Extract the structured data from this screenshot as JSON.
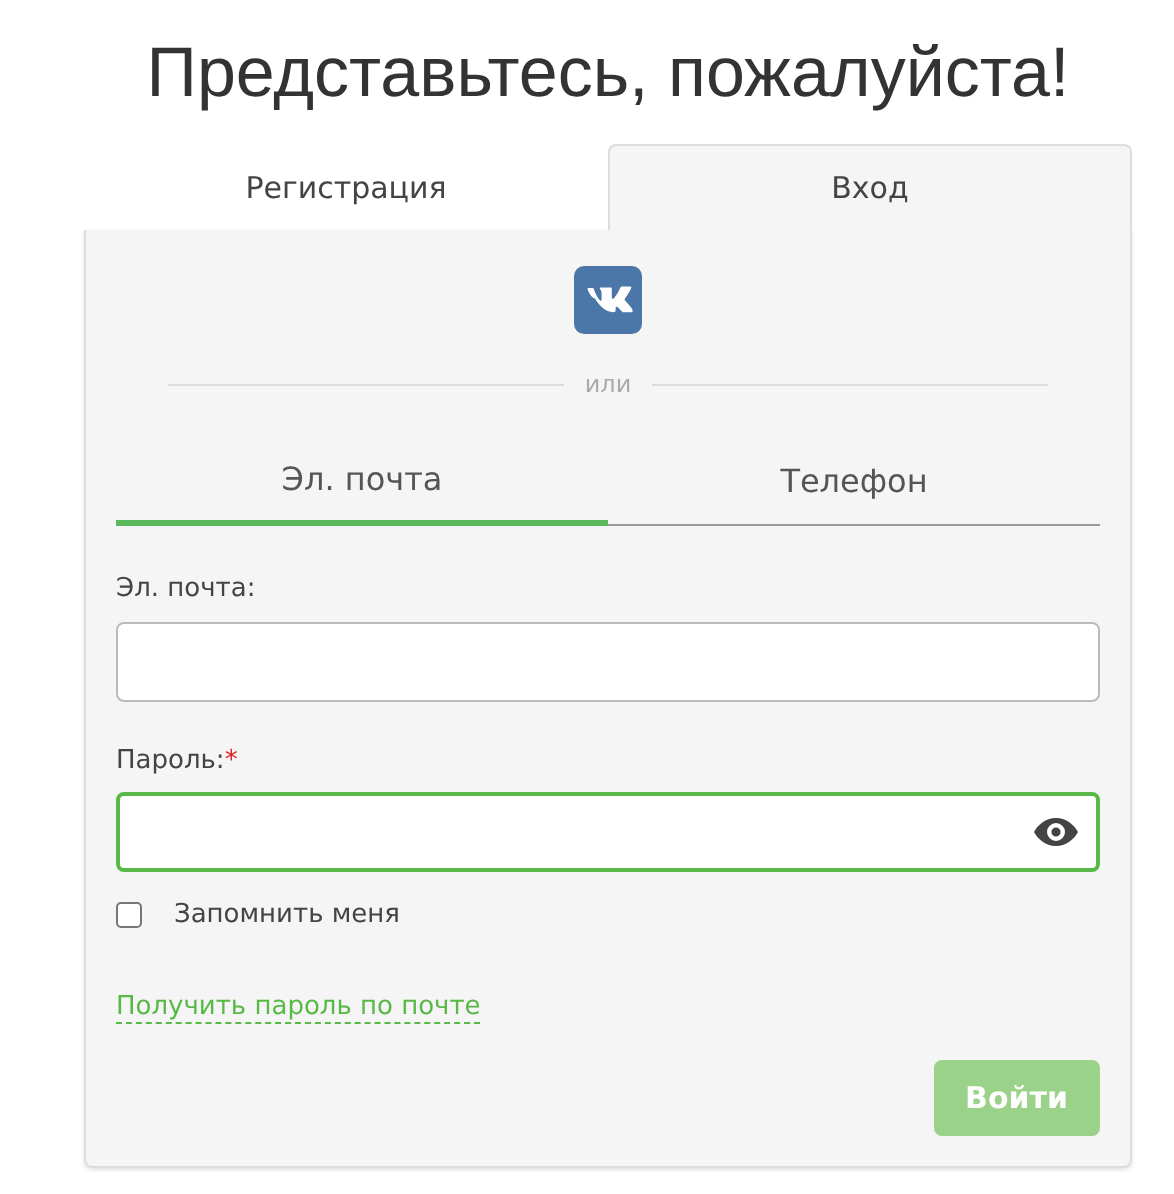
{
  "title": "Представьтесь, пожалуйста!",
  "auth_tabs": [
    {
      "label": "Регистрация",
      "selected": false
    },
    {
      "label": "Вход",
      "selected": true
    }
  ],
  "divider_text": "или",
  "method_tabs": [
    {
      "label": "Эл. почта",
      "selected": true
    },
    {
      "label": "Телефон",
      "selected": false
    }
  ],
  "fields": [
    {
      "kind": "text",
      "label": "Эл. почта:",
      "focused": false
    },
    {
      "kind": "password",
      "label": "Пароль:",
      "required_mark": "*",
      "focused": true
    }
  ],
  "remember": {
    "label": "Запомнить меня",
    "checked": false
  },
  "link": "Получить пароль по почте",
  "submit": {
    "label": "Войти",
    "disabled": true
  }
}
